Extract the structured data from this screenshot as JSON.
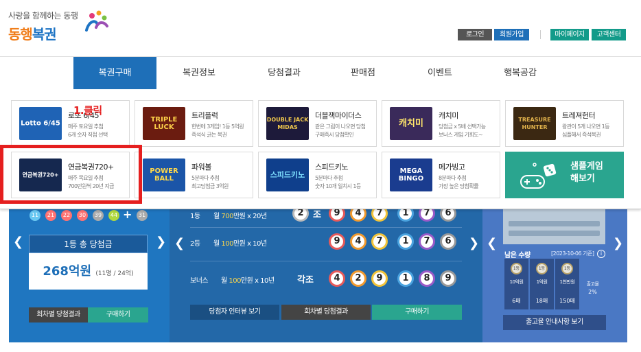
{
  "header": {
    "slogan": "사랑을 함께하는 동행",
    "brand_a": "동행",
    "brand_b": "복권",
    "login": "로그인",
    "signup": "회원가입",
    "mypage": "마이페이지",
    "support": "고객센터"
  },
  "nav": {
    "items": [
      "복권구매",
      "복권정보",
      "당첨결과",
      "판매점",
      "이벤트",
      "행복공감"
    ]
  },
  "dropdown": {
    "cards": [
      {
        "thumb": "Lotto 6/45",
        "title": "로또 6/45",
        "d1": "매주 토요일 추첨",
        "d2": "6개 숫자 직접 선택"
      },
      {
        "thumb": "TRIPLE LUCK",
        "title": "트리플럭",
        "d1": "한번에 3게임! 1등 5억원",
        "d2": "즉석식 긁는 복권"
      },
      {
        "thumb": "DOUBLE JACK MIDAS",
        "title": "더블잭마이더스",
        "d1": "같은 그림이 나오면 당첨",
        "d2": "구매즉시 당첨확인"
      },
      {
        "thumb": "캐치미",
        "title": "캐치미",
        "d1": "당첨금 x 5배 선택가능",
        "d2": "보너스 게임 기회도~"
      },
      {
        "thumb": "TREASURE HUNTER",
        "title": "트레져헌터",
        "d1": "왕관이 5개 나오면 1등",
        "d2": "심플해서 즉석복권"
      },
      {
        "thumb": "연금복권720+",
        "title": "연금복권720+",
        "d1": "매주 목요일 추첨",
        "d2": "700만원씩 20년 지급"
      },
      {
        "thumb": "POWER BALL",
        "title": "파워볼",
        "d1": "5분마다 추첨",
        "d2": "최고당첨금 3억원"
      },
      {
        "thumb": "스피드키노",
        "title": "스피드키노",
        "d1": "5분마다 추첨",
        "d2": "숫자 10개 일치시 1등"
      },
      {
        "thumb": "MEGA BINGO",
        "title": "메가빙고",
        "d1": "8분마다 추첨",
        "d2": "가장 높은 당첨확률"
      }
    ],
    "sample": {
      "line1": "샘플게임",
      "line2": "해보기"
    }
  },
  "annotation": "1.클릭",
  "lotto": {
    "balls": [
      "11",
      "21",
      "22",
      "30",
      "39",
      "44"
    ],
    "bonus": "31",
    "box_title": "1등 총 당첨금",
    "amount": "268억원",
    "amount_sub": "(11명 / 24억)",
    "btn_results": "회차별 당첨결과",
    "btn_buy": "구매하기"
  },
  "pension": {
    "r1_label": "1등",
    "r1_prize_a": "월 ",
    "r1_prize_b": "700",
    "r1_prize_c": "만원 x 20년",
    "r1_jo": "2",
    "r1_jo_text": "조",
    "r1_nums": [
      "9",
      "4",
      "7",
      "1",
      "7",
      "6"
    ],
    "r2_label": "2등",
    "r2_prize_a": "월 ",
    "r2_prize_b": "100",
    "r2_prize_c": "만원 x 10년",
    "r2_nums": [
      "9",
      "4",
      "7",
      "1",
      "7",
      "6"
    ],
    "r3_label": "보너스",
    "r3_prize_a": "월 ",
    "r3_prize_b": "100",
    "r3_prize_c": "만원 x 10년",
    "r3_jo": "각조",
    "r3_nums": [
      "4",
      "2",
      "9",
      "1",
      "8",
      "9"
    ],
    "btn_interview": "당첨자 인터뷰 보기",
    "btn_results": "회차별 당첨결과",
    "btn_buy": "구매하기"
  },
  "speetto": {
    "remain_label": "남은 수량",
    "date": "[2023-10-06 기준]",
    "cols": [
      {
        "medal": "1등",
        "label": "10억원",
        "value": "6매"
      },
      {
        "medal": "1등",
        "label": "1억원",
        "value": "18매"
      },
      {
        "medal": "1등",
        "label": "1천만원",
        "value": "150매"
      },
      {
        "medal": "",
        "label": "출고율",
        "value": "2%"
      }
    ],
    "btn_notice": "출고율 안내사항 보기"
  },
  "colors": {
    "nav_active": "#1e6fb8",
    "annotation_red": "#e51f1f",
    "sample_green": "#2aa58f"
  }
}
